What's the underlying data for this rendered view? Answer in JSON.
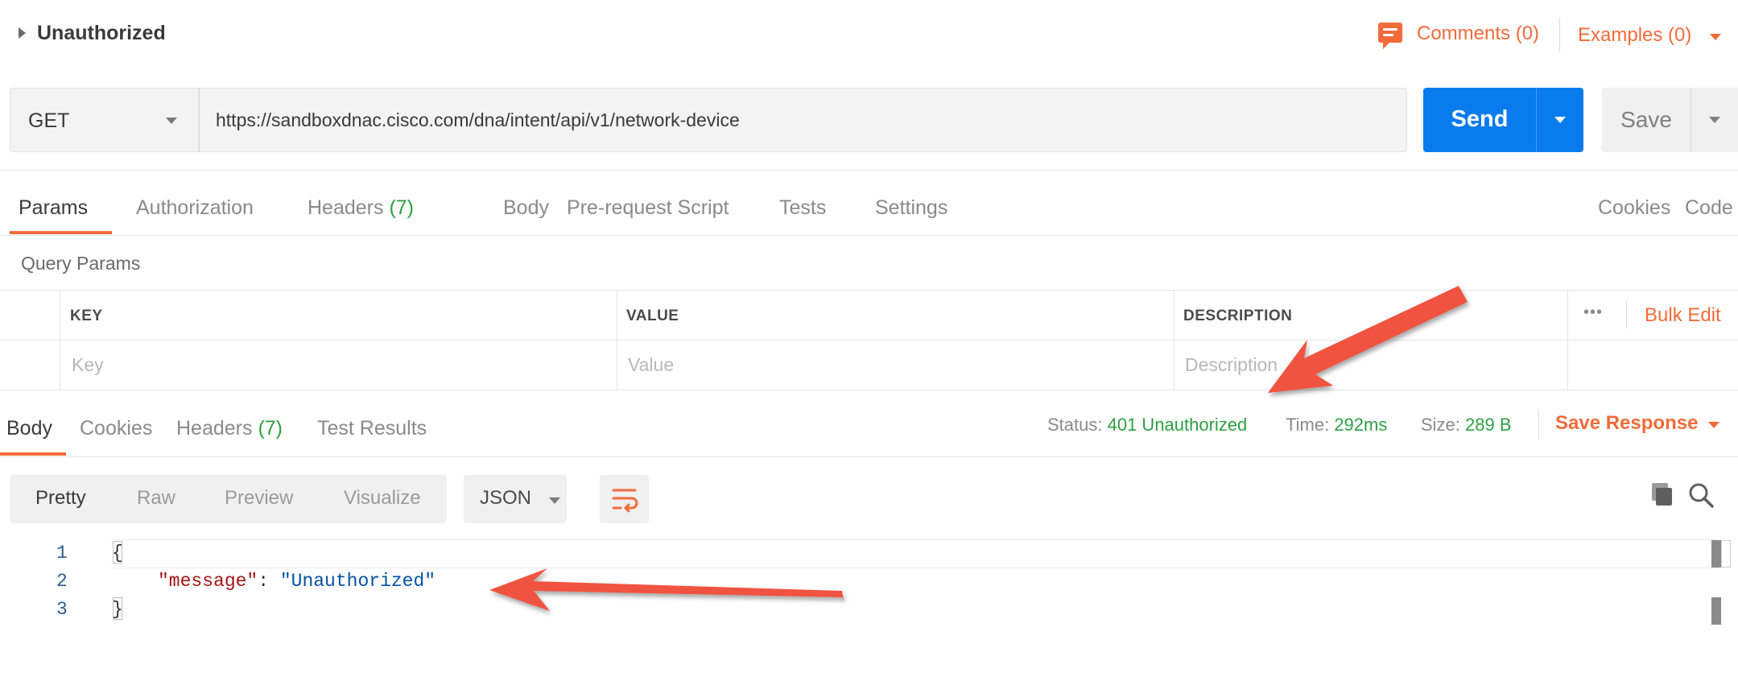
{
  "request": {
    "title": "Unauthorized",
    "comments_label": "Comments (0)",
    "examples_label": "Examples (0)",
    "method": "GET",
    "url": "https://sandboxdnac.cisco.com/dna/intent/api/v1/network-device",
    "send_label": "Send",
    "save_label": "Save"
  },
  "request_tabs": [
    {
      "label": "Params",
      "count": ""
    },
    {
      "label": "Authorization",
      "count": ""
    },
    {
      "label": "Headers",
      "count": "(7)"
    },
    {
      "label": "Body",
      "count": ""
    },
    {
      "label": "Pre-request Script",
      "count": ""
    },
    {
      "label": "Tests",
      "count": ""
    },
    {
      "label": "Settings",
      "count": ""
    }
  ],
  "request_links": {
    "cookies": "Cookies",
    "code": "Code"
  },
  "query_params": {
    "section_label": "Query Params",
    "columns": [
      "KEY",
      "VALUE",
      "DESCRIPTION"
    ],
    "bulk_edit": "Bulk Edit",
    "more": "•••",
    "placeholders": [
      "Key",
      "Value",
      "Description"
    ]
  },
  "response_tabs": [
    {
      "label": "Body",
      "count": ""
    },
    {
      "label": "Cookies",
      "count": ""
    },
    {
      "label": "Headers",
      "count": "(7)"
    },
    {
      "label": "Test Results",
      "count": ""
    }
  ],
  "response_meta": {
    "status_label": "Status:",
    "status_value": "401 Unauthorized",
    "time_label": "Time:",
    "time_value": "292ms",
    "size_label": "Size:",
    "size_value": "289 B",
    "save_response": "Save Response"
  },
  "view_modes": [
    "Pretty",
    "Raw",
    "Preview",
    "Visualize"
  ],
  "format": "JSON",
  "code_lines": [
    {
      "num": "1",
      "text": "{"
    },
    {
      "num": "2",
      "key": "\"message\"",
      "sep": ": ",
      "value": "\"Unauthorized\""
    },
    {
      "num": "3",
      "text": "}"
    }
  ],
  "colors": {
    "accent": "#f26b3a",
    "send": "#097bed",
    "success": "#2ea043",
    "annotation_arrow": "#f0533f"
  }
}
